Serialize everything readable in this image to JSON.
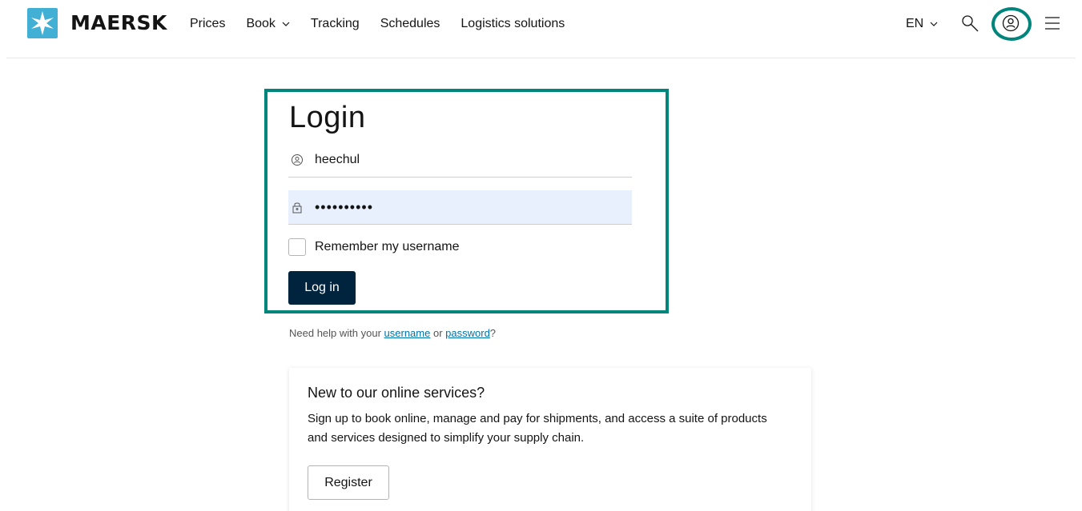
{
  "header": {
    "brand": "MAERSK",
    "nav": [
      {
        "label": "Prices"
      },
      {
        "label": "Book"
      },
      {
        "label": "Tracking"
      },
      {
        "label": "Schedules"
      },
      {
        "label": "Logistics solutions"
      }
    ],
    "language": "EN",
    "icons": {
      "logo": "maersk-star-logo",
      "search": "search-icon",
      "profile": "profile-icon",
      "menu": "hamburger-menu-icon"
    }
  },
  "login": {
    "title": "Login",
    "username_value": "heechul",
    "password_value": "password12",
    "remember_label": "Remember my username",
    "remember_checked": false,
    "submit_label": "Log in"
  },
  "help": {
    "prefix": "Need help with your",
    "username_link": "username",
    "or": "or",
    "password_link": "password",
    "suffix": "?"
  },
  "register_card": {
    "title": "New to our online services?",
    "text": "Sign up to book online, manage and pay for shipments, and access a suite of products and services designed to simplify your supply chain.",
    "button_label": "Register"
  },
  "colors": {
    "accent_highlight": "#00857c",
    "brand_blue": "#42b0d5",
    "primary_button": "#00243d",
    "link": "#0073ab",
    "autofill_bg": "#e8f0fe"
  }
}
